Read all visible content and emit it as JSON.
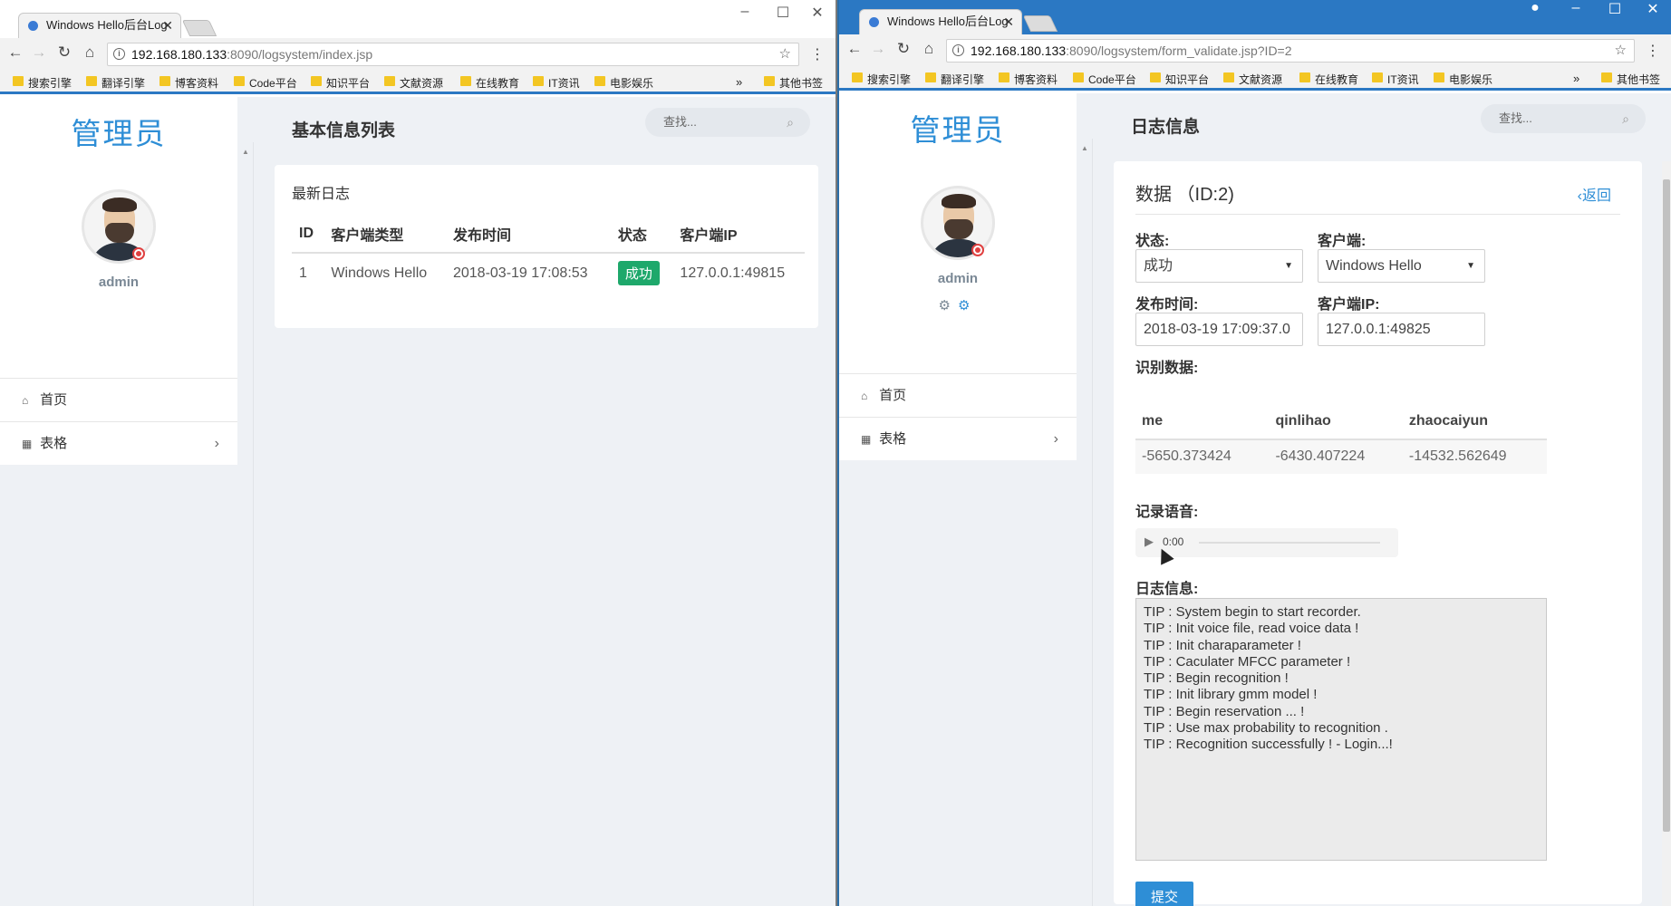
{
  "left": {
    "tab_title": "Windows Hello后台Log",
    "url_host": "192.168.180.133",
    "url_path": ":8090/logsystem/index.jsp",
    "bookmarks": [
      "搜索引擎",
      "翻译引擎",
      "博客资料",
      "Code平台",
      "知识平台",
      "文献资源",
      "在线教育",
      "IT资讯",
      "电影娱乐"
    ],
    "bookmarks_more": "»",
    "bookmarks_other": "其他书签",
    "brand": "管理员",
    "username": "admin",
    "menu": [
      {
        "icon": "home-icon",
        "label": "首页"
      },
      {
        "icon": "table-icon",
        "label": "表格"
      }
    ],
    "page_title": "基本信息列表",
    "search_placeholder": "查找...",
    "card_title": "最新日志",
    "table": {
      "headers": [
        "ID",
        "客户端类型",
        "发布时间",
        "状态",
        "客户端IP"
      ],
      "rows": [
        [
          "1",
          "Windows Hello",
          "2018-03-19 17:08:53",
          "成功",
          "127.0.0.1:49815"
        ]
      ]
    }
  },
  "right": {
    "tab_title": "Windows Hello后台Log",
    "url_host": "192.168.180.133",
    "url_path": ":8090/logsystem/form_validate.jsp?ID=2",
    "bookmarks": [
      "搜索引擎",
      "翻译引擎",
      "博客资料",
      "Code平台",
      "知识平台",
      "文献资源",
      "在线教育",
      "IT资讯",
      "电影娱乐"
    ],
    "bookmarks_more": "»",
    "bookmarks_other": "其他书签",
    "brand": "管理员",
    "username": "admin",
    "menu": [
      {
        "icon": "home-icon",
        "label": "首页"
      },
      {
        "icon": "table-icon",
        "label": "表格"
      }
    ],
    "page_title": "日志信息",
    "search_placeholder": "查找...",
    "form": {
      "heading": "数据 （ID:2)",
      "back_label": "返回",
      "status_label": "状态:",
      "status_value": "成功",
      "client_label": "客户端:",
      "client_value": "Windows Hello",
      "time_label": "发布时间:",
      "time_value": "2018-03-19 17:09:37.0",
      "ip_label": "客户端IP:",
      "ip_value": "127.0.0.1:49825",
      "recog_label": "识别数据:",
      "recog_headers": [
        "me",
        "qinlihao",
        "zhaocaiyun"
      ],
      "recog_values": [
        "-5650.373424",
        "-6430.407224",
        "-14532.562649"
      ],
      "voice_label": "记录语音:",
      "audio_time": "0:00",
      "log_label": "日志信息:",
      "log_text": "TIP : System begin to start recorder.\nTIP : Init voice file, read voice data !\nTIP : Init charaparameter !\nTIP : Caculater MFCC parameter !\nTIP : Begin recognition !\nTIP : Init library gmm model !\nTIP : Begin reservation ... !\nTIP : Use max probability to recognition .\nTIP : Recognition successfully ! - Login...!",
      "submit_label": "提交"
    }
  }
}
